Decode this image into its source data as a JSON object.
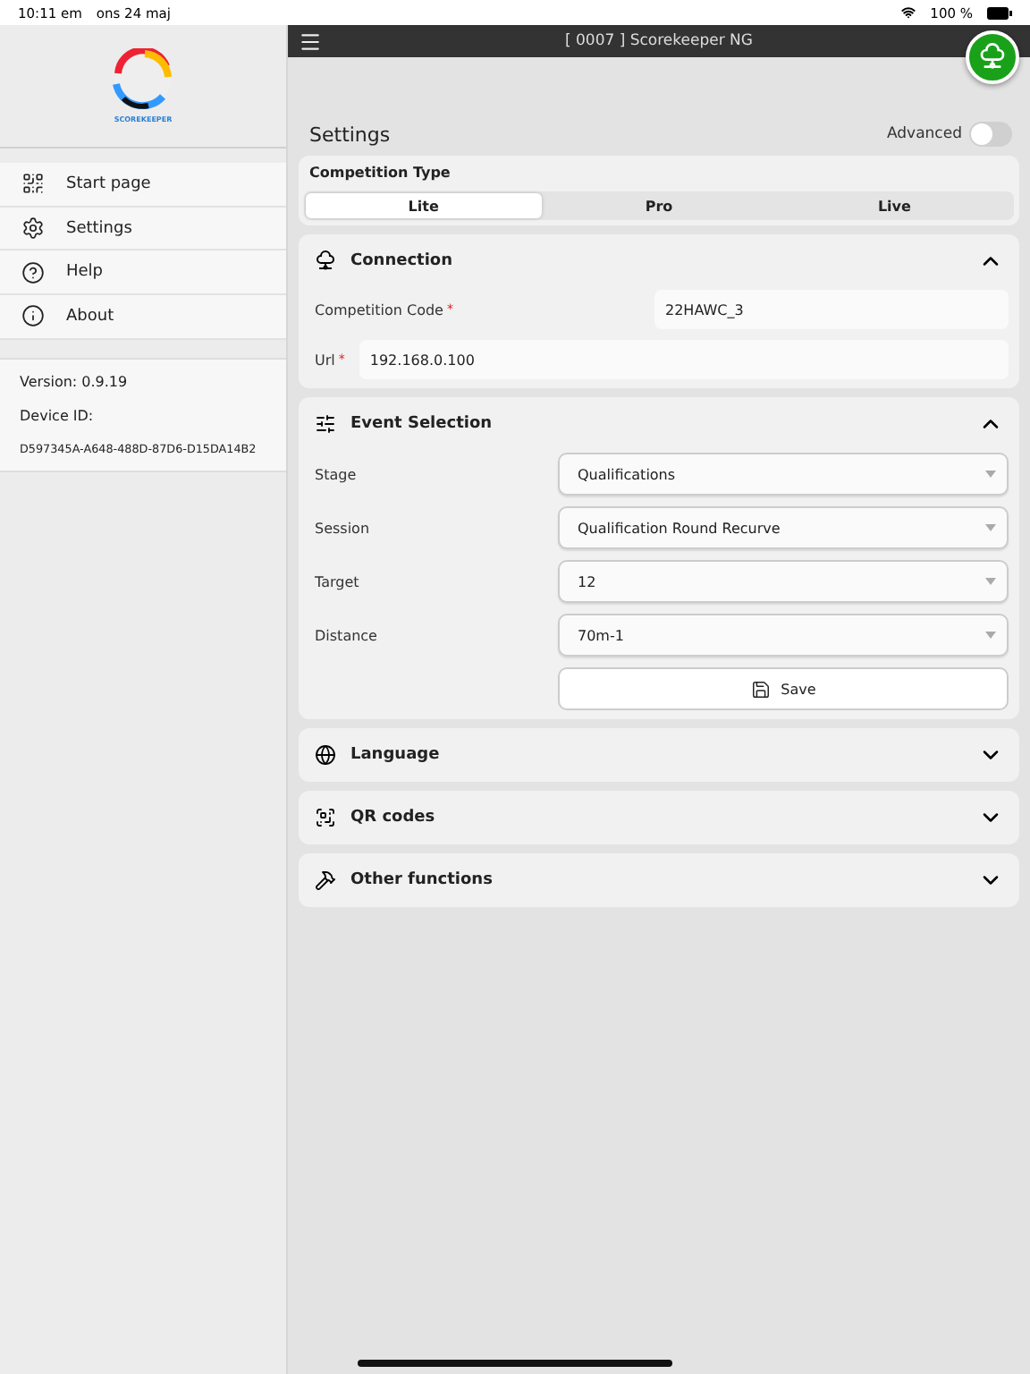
{
  "status_bar": {
    "time": "10:11 em",
    "date": "ons 24 maj",
    "battery": "100 %"
  },
  "sidebar": {
    "logo_text": "SCOREKEEPER",
    "items": [
      {
        "label": "Start page"
      },
      {
        "label": "Settings"
      },
      {
        "label": "Help"
      },
      {
        "label": "About"
      }
    ],
    "version": "Version: 0.9.19",
    "device_id_label": "Device ID:",
    "device_id": "D597345A-A648-488D-87D6-D15DA14B2"
  },
  "header": {
    "title": "[ 0007 ] Scorekeeper NG"
  },
  "settings": {
    "title": "Settings",
    "advanced": {
      "label": "Advanced",
      "on": false
    },
    "competition_type": {
      "label": "Competition Type",
      "options": [
        {
          "label": "Lite",
          "selected": true
        },
        {
          "label": "Pro",
          "selected": false
        },
        {
          "label": "Live",
          "selected": false
        }
      ]
    },
    "sections": [
      {
        "title": "Connection",
        "expanded": true,
        "fields": [
          {
            "kind": "text",
            "label": "Competition Code",
            "required_mark": "*",
            "value": "22HAWC_3"
          },
          {
            "kind": "text",
            "label": "Url",
            "required_mark": "*",
            "value": "192.168.0.100"
          }
        ]
      },
      {
        "title": "Event Selection",
        "expanded": true,
        "fields": [
          {
            "kind": "select",
            "label": "Stage",
            "value": "Qualifications"
          },
          {
            "kind": "select",
            "label": "Session",
            "value": "Qualification Round Recurve"
          },
          {
            "kind": "select",
            "label": "Target",
            "value": "12"
          },
          {
            "kind": "select",
            "label": "Distance",
            "value": "70m-1"
          },
          {
            "kind": "button",
            "label": "Save"
          }
        ]
      },
      {
        "title": "Language",
        "expanded": false
      },
      {
        "title": "QR codes",
        "expanded": false
      },
      {
        "title": "Other functions",
        "expanded": false
      }
    ]
  }
}
